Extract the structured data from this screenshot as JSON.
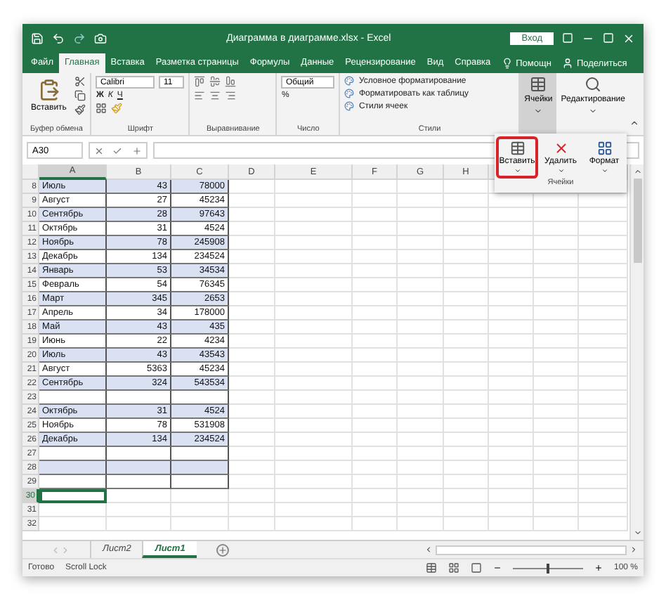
{
  "title_bar": {
    "title": "Диаграмма в диаграмме.xlsx  -  Excel",
    "sign_in": "Вход"
  },
  "tabs": [
    {
      "label": "Файл",
      "selected": false
    },
    {
      "label": "Главная",
      "selected": true
    },
    {
      "label": "Вставка",
      "selected": false
    },
    {
      "label": "Разметка страницы",
      "selected": false
    },
    {
      "label": "Формулы",
      "selected": false
    },
    {
      "label": "Данные",
      "selected": false
    },
    {
      "label": "Рецензирование",
      "selected": false
    },
    {
      "label": "Вид",
      "selected": false
    },
    {
      "label": "Справка",
      "selected": false
    }
  ],
  "tell_me": "Помощн",
  "share": "Поделиться",
  "ribbon": {
    "paste": "Вставить",
    "font_name": "Calibri",
    "font_size": "11",
    "bold": "Ж",
    "italic": "К",
    "underline": "Ч",
    "number_format": "Общий",
    "percent": "%",
    "styles": [
      "Условное форматирование",
      "Форматировать как таблицу",
      "Стили ячеек"
    ],
    "cells": "Ячейки",
    "editing": "Редактирование",
    "groups": [
      "Буфер обмена",
      "Шрифт",
      "Выравнивание",
      "Число",
      "Стили"
    ]
  },
  "cells_menu": {
    "caption": "Ячейки",
    "items": [
      {
        "kind": "insert",
        "label": "Вставить",
        "selected": true
      },
      {
        "kind": "delete",
        "label": "Удалить",
        "selected": false
      },
      {
        "kind": "format",
        "label": "Формат",
        "selected": false
      }
    ]
  },
  "formula_bar": {
    "name_box": "A30"
  },
  "columns": [
    "A",
    "B",
    "C",
    "D",
    "E",
    "F",
    "G",
    "H"
  ],
  "rows": [
    {
      "num": "8",
      "a": "Июль",
      "b": "43",
      "c": "78000",
      "shaded": true
    },
    {
      "num": "9",
      "a": "Август",
      "b": "27",
      "c": "45234",
      "shaded": false
    },
    {
      "num": "10",
      "a": "Сентябрь",
      "b": "28",
      "c": "97643",
      "shaded": true
    },
    {
      "num": "11",
      "a": "Октябрь",
      "b": "31",
      "c": "4524",
      "shaded": false
    },
    {
      "num": "12",
      "a": "Ноябрь",
      "b": "78",
      "c": "245908",
      "shaded": true
    },
    {
      "num": "13",
      "a": "Декабрь",
      "b": "134",
      "c": "234524",
      "shaded": false
    },
    {
      "num": "14",
      "a": "Январь",
      "b": "53",
      "c": "34534",
      "shaded": true
    },
    {
      "num": "15",
      "a": "Февраль",
      "b": "54",
      "c": "76345",
      "shaded": false
    },
    {
      "num": "16",
      "a": "Март",
      "b": "345",
      "c": "2653",
      "shaded": true
    },
    {
      "num": "17",
      "a": "Апрель",
      "b": "34",
      "c": "178000",
      "shaded": false
    },
    {
      "num": "18",
      "a": "Май",
      "b": "43",
      "c": "435",
      "shaded": true
    },
    {
      "num": "19",
      "a": "Июнь",
      "b": "22",
      "c": "4234",
      "shaded": false
    },
    {
      "num": "20",
      "a": "Июль",
      "b": "43",
      "c": "43543",
      "shaded": true
    },
    {
      "num": "21",
      "a": "Август",
      "b": "5363",
      "c": "45234",
      "shaded": false
    },
    {
      "num": "22",
      "a": "Сентябрь",
      "b": "324",
      "c": "543534",
      "shaded": true
    },
    {
      "num": "23",
      "shaded": false
    },
    {
      "num": "24",
      "a": "Октябрь",
      "b": "31",
      "c": "4524",
      "shaded": true
    },
    {
      "num": "25",
      "a": "Ноябрь",
      "b": "78",
      "c": "531908",
      "shaded": false
    },
    {
      "num": "26",
      "a": "Декабрь",
      "b": "134",
      "c": "234524",
      "shaded": true
    },
    {
      "num": "27",
      "shaded": false
    },
    {
      "num": "28",
      "shaded": true
    },
    {
      "num": "29",
      "shaded": false
    },
    {
      "num": "30",
      "selected": true
    },
    {
      "num": "31",
      "selected": false
    },
    {
      "num": "32",
      "selected": false
    }
  ],
  "sheets": [
    {
      "label": "Лист2",
      "selected": false
    },
    {
      "label": "Лист1",
      "selected": true
    }
  ],
  "status": [
    "Готово",
    "Scroll Lock"
  ],
  "zoom": {
    "label": "100 %",
    "level": 0.5
  }
}
